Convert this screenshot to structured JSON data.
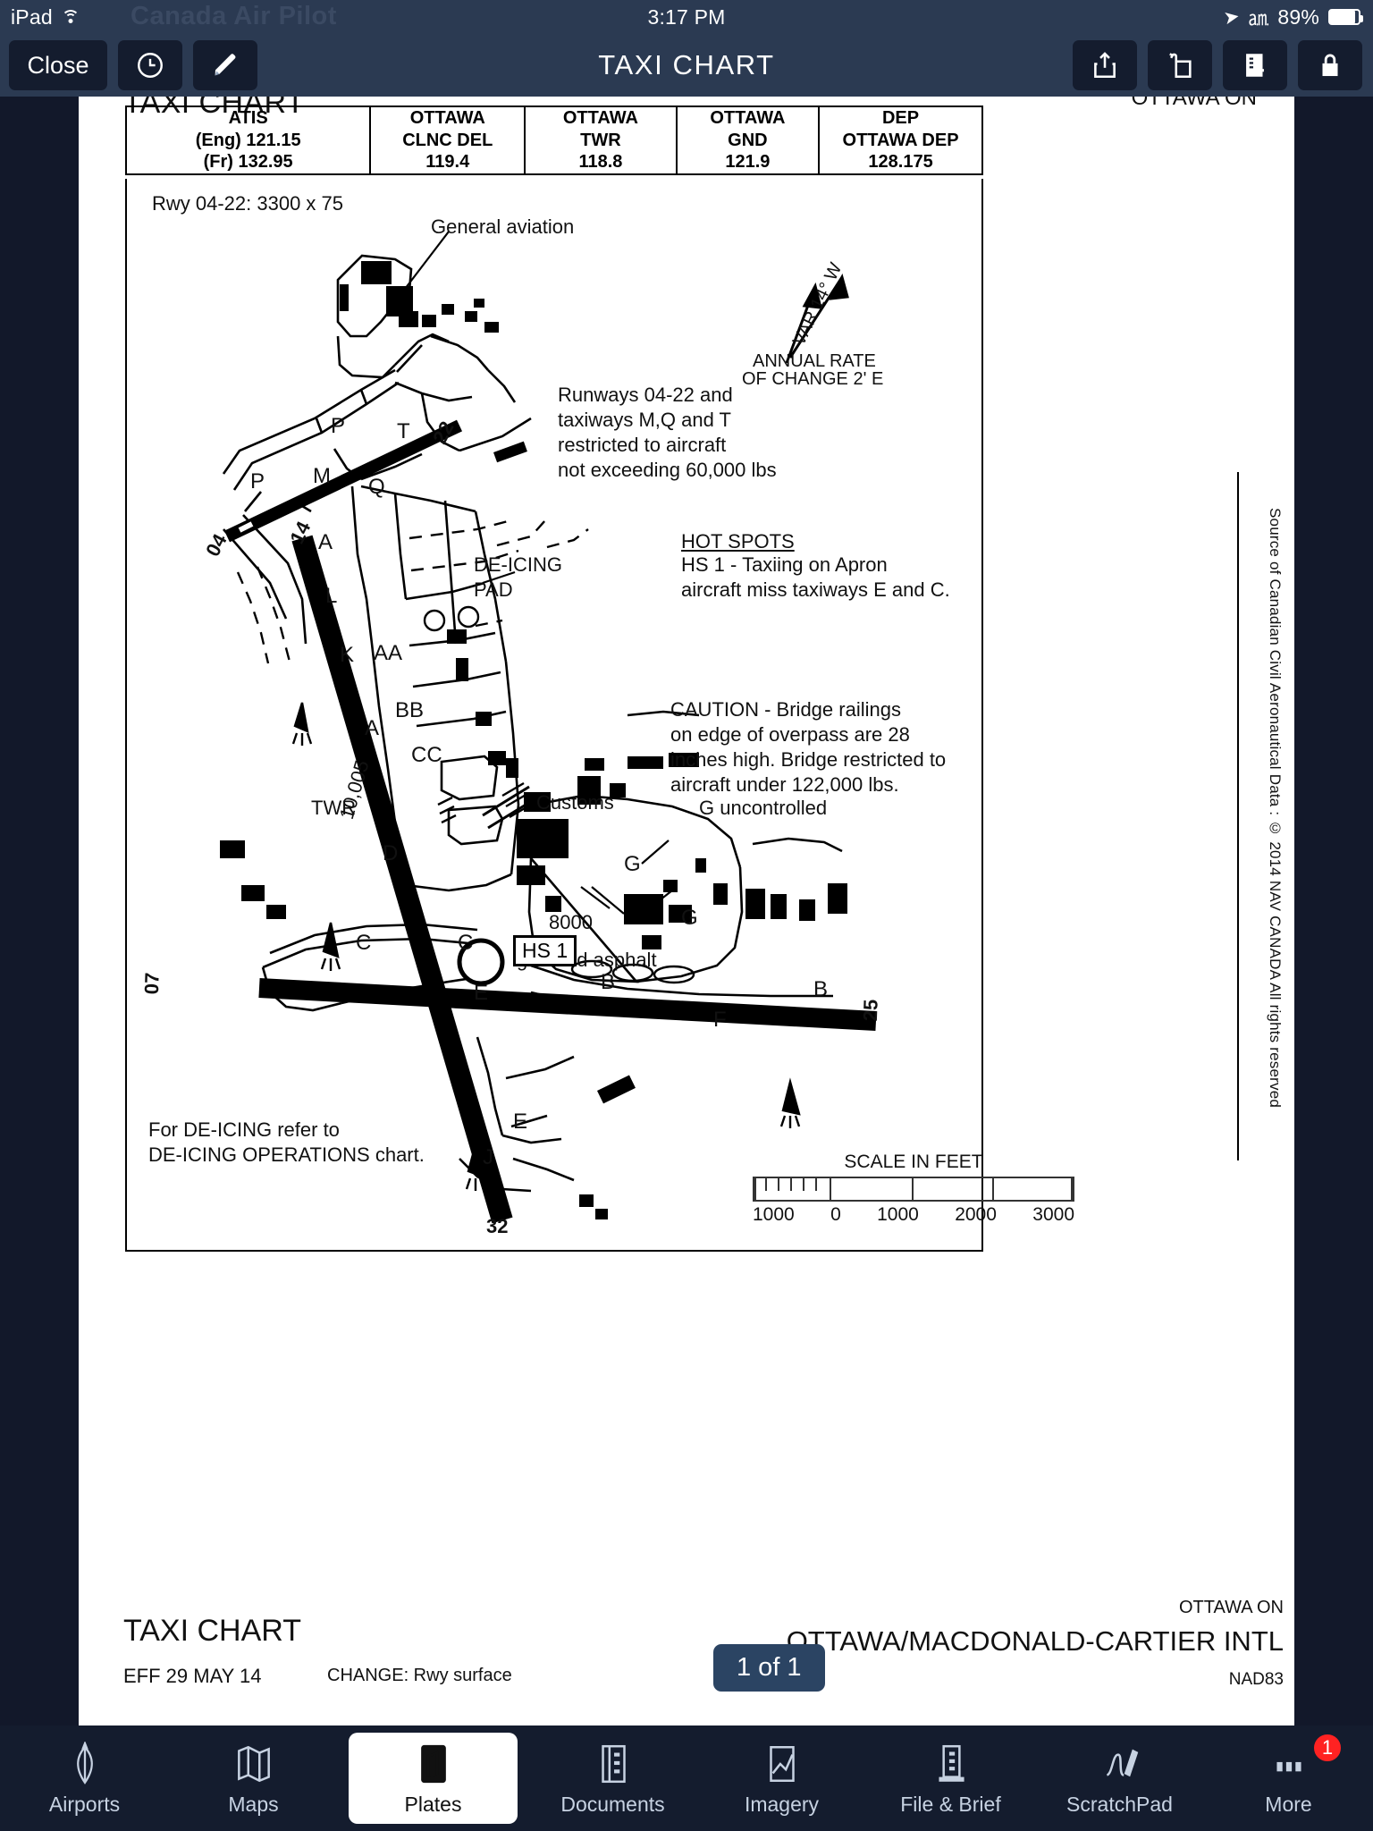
{
  "statusbar": {
    "device": "iPad",
    "wifi_icon": "wifi-icon",
    "ghost_app_title": "Canada Air Pilot",
    "time": "3:17 PM",
    "location_icon": "location-arrow-icon",
    "bluetooth_icon": "bluetooth-icon",
    "battery_percent": "89%"
  },
  "navbar": {
    "close_label": "Close",
    "clock_icon": "clock-icon",
    "annotate_icon": "pencil-icon",
    "title": "TAXI CHART",
    "share_icon": "share-upload-icon",
    "send_icon": "send-to-device-icon",
    "binder_icon": "add-to-binder-icon",
    "lock_icon": "lock-icon"
  },
  "chart": {
    "header_title": "TAXI CHART",
    "header_right": "OTTAWA ON",
    "frequencies": [
      {
        "name": "ATIS",
        "lines": [
          "(Eng) 121.15",
          "(Fr) 132.95"
        ]
      },
      {
        "name": "OTTAWA",
        "lines": [
          "CLNC DEL",
          "119.4"
        ]
      },
      {
        "name": "OTTAWA",
        "lines": [
          "TWR",
          "118.8"
        ]
      },
      {
        "name": "OTTAWA",
        "lines": [
          "GND",
          "121.9"
        ]
      },
      {
        "name": "DEP",
        "lines": [
          "OTTAWA DEP",
          "128.175"
        ]
      }
    ],
    "runway_note": "Rwy 04-22: 3300 x 75",
    "general_aviation": "General aviation",
    "variation": "VAR 14° W",
    "annual_rate": "ANNUAL RATE",
    "annual_rate2": "OF CHANGE 2' E",
    "restriction_note": "Runways 04-22 and\ntaxiways M,Q and T\nrestricted to aircraft\nnot exceeding 60,000 lbs",
    "hot_spots_title": "HOT SPOTS",
    "hot_spots_body": "HS 1 - Taxiing on Apron\naircraft miss taxiways E and C.",
    "caution_note": "CAUTION - Bridge railings\non edge of overpass are 28\ninches high. Bridge restricted to\naircraft under 122,000 lbs.",
    "deicing_pad": "DE-ICING\nPAD",
    "deicing_refer": "For DE-ICING refer to\nDE-ICING OPERATIONS chart.",
    "customs": "Customs",
    "g_uncontrolled": "G uncontrolled",
    "tower": "TWR",
    "grooved_asphalt": "grooved asphalt",
    "hs1_box": "HS 1",
    "rwy_len_8000": "8000",
    "rwy_len_10005": "10,005",
    "source_note": "Source of Canadian Civil Aeronautical Data : © 2014 NAV CANADA All rights reserved",
    "runway_ends": [
      "04",
      "22",
      "07",
      "25",
      "14",
      "32"
    ],
    "taxiway_labels": [
      "P",
      "T",
      "P",
      "M",
      "Q",
      "A",
      "L",
      "K",
      "AA",
      "BB",
      "CC",
      "A",
      "D",
      "C",
      "C",
      "E",
      "B",
      "B",
      "F",
      "G",
      "G",
      "E",
      "J"
    ],
    "scale": {
      "title": "SCALE IN FEET",
      "ticks": [
        "1000",
        "0",
        "1000",
        "2000",
        "3000"
      ]
    },
    "footer": {
      "title": "TAXI CHART",
      "eff": "EFF 29 MAY 14",
      "change": "CHANGE: Rwy surface",
      "region": "OTTAWA ON",
      "airport": "OTTAWA/MACDONALD-CARTIER INTL",
      "datum": "NAD83"
    }
  },
  "page_indicator": "1 of 1",
  "tabbar": {
    "items": [
      {
        "label": "Airports",
        "icon": "airports-compass-icon",
        "active": false
      },
      {
        "label": "Maps",
        "icon": "map-folded-icon",
        "active": false
      },
      {
        "label": "Plates",
        "icon": "plates-icon",
        "active": true
      },
      {
        "label": "Documents",
        "icon": "documents-icon",
        "active": false
      },
      {
        "label": "Imagery",
        "icon": "imagery-icon",
        "active": false
      },
      {
        "label": "File & Brief",
        "icon": "file-brief-icon",
        "active": false
      },
      {
        "label": "ScratchPad",
        "icon": "scratchpad-pen-icon",
        "active": false
      },
      {
        "label": "More",
        "icon": "more-dots-icon",
        "active": false,
        "badge": "1"
      }
    ]
  },
  "colors": {
    "chrome": "#2b3a52",
    "chrome_dark": "#141c2e",
    "accent_pill": "#2b4463",
    "badge_red": "#f22222"
  }
}
